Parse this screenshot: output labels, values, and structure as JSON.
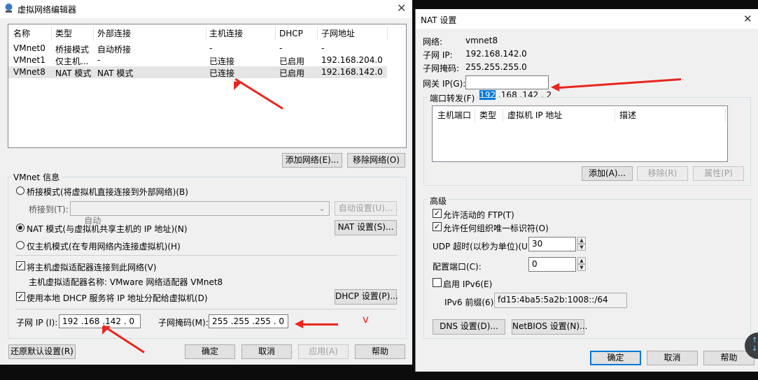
{
  "left_window": {
    "title": "虚拟网络编辑器",
    "table": {
      "headers": [
        "名称",
        "类型",
        "外部连接",
        "主机连接",
        "DHCP",
        "子网地址"
      ],
      "rows": [
        [
          "VMnet0",
          "桥接模式",
          "自动桥接",
          "-",
          "-",
          "-"
        ],
        [
          "VMnet1",
          "仅主机...",
          "-",
          "已连接",
          "已启用",
          "192.168.204.0"
        ],
        [
          "VMnet8",
          "NAT 模式",
          "NAT 模式",
          "已连接",
          "已启用",
          "192.168.142.0"
        ]
      ]
    },
    "add_network": "添加网络(E)...",
    "remove_network": "移除网络(O)",
    "vmnet_info": "VMnet 信息",
    "bridge_mode": "桥接模式(将虚拟机直接连接到外部网络)(B)",
    "bridge_to_label": "桥接到(T):",
    "bridge_to_value": "自动",
    "auto_settings": "自动设置(U)...",
    "nat_mode": "NAT 模式(与虚拟机共享主机的 IP 地址)(N)",
    "nat_settings": "NAT 设置(S)...",
    "host_only_mode": "仅主机模式(在专用网络内连接虚拟机)(H)",
    "connect_adapter": "将主机虚拟适配器连接到此网络(V)",
    "adapter_name": "主机虚拟适配器名称: VMware 网络适配器 VMnet8",
    "use_dhcp": "使用本地 DHCP 服务将 IP 地址分配给虚拟机(D)",
    "dhcp_settings": "DHCP 设置(P)...",
    "subnet_ip_label": "子网 IP (I):",
    "subnet_ip_value": "192 .168 .142 . 0",
    "subnet_mask_label": "子网掩码(M):",
    "subnet_mask_value": "255 .255 .255 . 0",
    "restore_defaults": "还原默认设置(R)",
    "ok": "确定",
    "cancel": "取消",
    "apply": "应用(A)",
    "help": "帮助",
    "annotation": "v"
  },
  "right_window": {
    "title": "NAT 设置",
    "network_label": "网络:",
    "network_value": "vmnet8",
    "subnet_ip_label": "子网 IP:",
    "subnet_ip_value": "192.168.142.0",
    "subnet_mask_label": "子网掩码:",
    "subnet_mask_value": "255.255.255.0",
    "gateway_label": "网关 IP(G):",
    "gateway_value_selected": "192",
    "gateway_value_rest": " .168 .142 . 2",
    "port_forward_title": "端口转发(F)",
    "port_headers": [
      "主机端口",
      "类型",
      "虚拟机 IP 地址",
      "描述"
    ],
    "add": "添加(A)...",
    "remove": "移除(R)",
    "properties": "属性(P)",
    "advanced_title": "高级",
    "allow_ftp": "允许活动的 FTP(T)",
    "allow_uid": "允许任何组织唯一标识符(O)",
    "udp_timeout_label": "UDP 超时(以秒为单位)(U):",
    "udp_timeout_value": "30",
    "config_port_label": "配置端口(C):",
    "config_port_value": "0",
    "enable_ipv6": "启用 IPv6(E)",
    "ipv6_prefix_label": "IPv6 前缀(6):",
    "ipv6_prefix_value": "fd15:4ba5:5a2b:1008::/64",
    "dns_settings": "DNS 设置(D)...",
    "netbios_settings": "NetBIOS 设置(N)...",
    "ok": "确定",
    "cancel": "取消",
    "help": "帮助"
  },
  "colors": {
    "annotation_red": "#e8251e",
    "selection_blue": "#0078d7",
    "row_selected": "#e5e5e5"
  }
}
